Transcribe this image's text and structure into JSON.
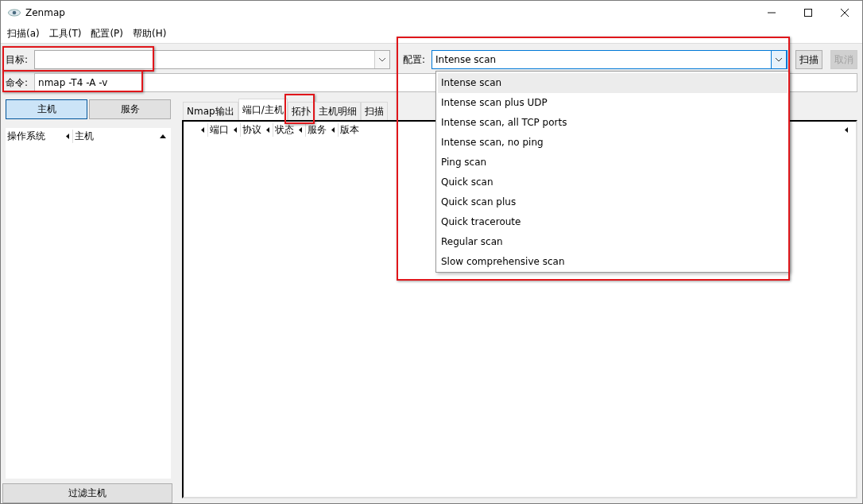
{
  "window": {
    "title": "Zenmap"
  },
  "menu": [
    {
      "label": "扫描(a)"
    },
    {
      "label": "工具(T)"
    },
    {
      "label": "配置(P)"
    },
    {
      "label": "帮助(H)"
    }
  ],
  "target": {
    "label": "目标:",
    "highlighted": true
  },
  "profile": {
    "label": "配置:",
    "value": "Intense scan",
    "expanded": true,
    "highlighted": true,
    "options": [
      {
        "label": "Intense scan",
        "selected": true
      },
      {
        "label": "Intense scan plus UDP",
        "selected": false
      },
      {
        "label": "Intense scan, all TCP ports",
        "selected": false
      },
      {
        "label": "Intense scan, no ping",
        "selected": false
      },
      {
        "label": "Ping scan",
        "selected": false
      },
      {
        "label": "Quick scan",
        "selected": false
      },
      {
        "label": "Quick scan plus",
        "selected": false
      },
      {
        "label": "Quick traceroute",
        "selected": false
      },
      {
        "label": "Regular scan",
        "selected": false
      },
      {
        "label": "Slow comprehensive scan",
        "selected": false
      }
    ]
  },
  "buttons": [
    {
      "label": "扫描",
      "disabled": false
    },
    {
      "label": "取消",
      "disabled": true
    }
  ],
  "command": {
    "label": "命令:",
    "value": "nmap -T4 -A -v",
    "highlighted": true
  },
  "view_toggle": [
    {
      "label": "主机",
      "selected": true
    },
    {
      "label": "服务",
      "selected": false
    }
  ],
  "host_columns": [
    {
      "label": "操作系统"
    },
    {
      "label": "主机"
    }
  ],
  "filter_button": "过滤主机",
  "tabs": [
    {
      "label": "Nmap输出",
      "selected": false,
      "highlighted": false
    },
    {
      "label": "端口/主机",
      "selected": true,
      "highlighted": false
    },
    {
      "label": "拓扑",
      "selected": false,
      "highlighted": true
    },
    {
      "label": "主机明细",
      "selected": false,
      "highlighted": false
    },
    {
      "label": "扫描",
      "selected": false,
      "highlighted": false
    }
  ],
  "port_columns": [
    {
      "label": "端口"
    },
    {
      "label": "协议"
    },
    {
      "label": "状态"
    },
    {
      "label": "服务"
    },
    {
      "label": "版本"
    }
  ]
}
